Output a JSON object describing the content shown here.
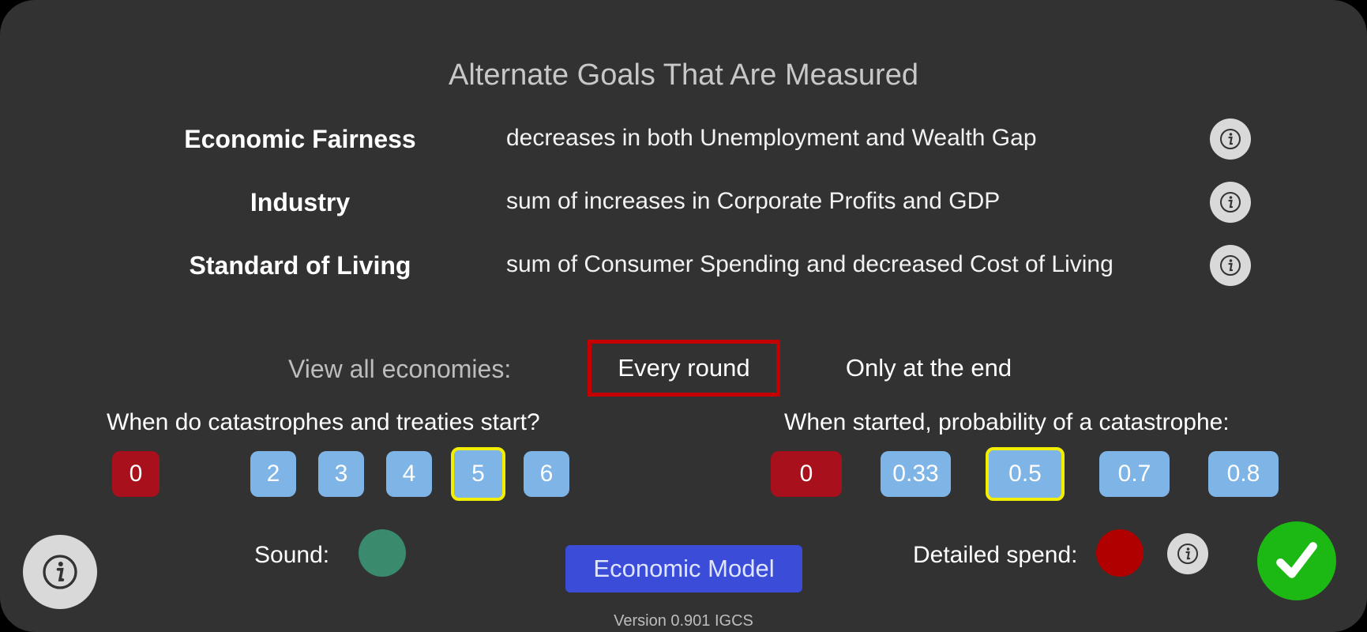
{
  "title": "Alternate Goals That Are Measured",
  "goals": [
    {
      "name": "Economic Fairness",
      "description": "decreases in both Unemployment and Wealth Gap"
    },
    {
      "name": "Industry",
      "description": "sum of increases in Corporate Profits and GDP"
    },
    {
      "name": "Standard of Living",
      "description": "sum of Consumer Spending and decreased Cost of Living"
    }
  ],
  "view": {
    "label": "View all economies:",
    "every_round": "Every round",
    "only_end": "Only at the end",
    "selected": "Every round"
  },
  "start": {
    "label": "When do catastrophes and treaties start?",
    "options": [
      "0",
      "2",
      "3",
      "4",
      "5",
      "6"
    ],
    "selected": "5"
  },
  "probability": {
    "label": "When started, probability of a catastrophe:",
    "options": [
      "0",
      "0.33",
      "0.5",
      "0.7",
      "0.8"
    ],
    "selected": "0.5"
  },
  "sound": {
    "label": "Sound:",
    "color": "#3a8a6e"
  },
  "detailed": {
    "label": "Detailed spend:",
    "color": "#b00000"
  },
  "model_button": "Economic Model",
  "version": "Version 0.901 IGCS",
  "icons": {
    "info": "info-icon",
    "confirm": "checkmark-icon"
  },
  "colors": {
    "background": "#323232",
    "accent_blue": "#7eb4e6",
    "selected_outline": "#f2ee00",
    "red": "#a8101c",
    "confirm": "#1cb814"
  }
}
